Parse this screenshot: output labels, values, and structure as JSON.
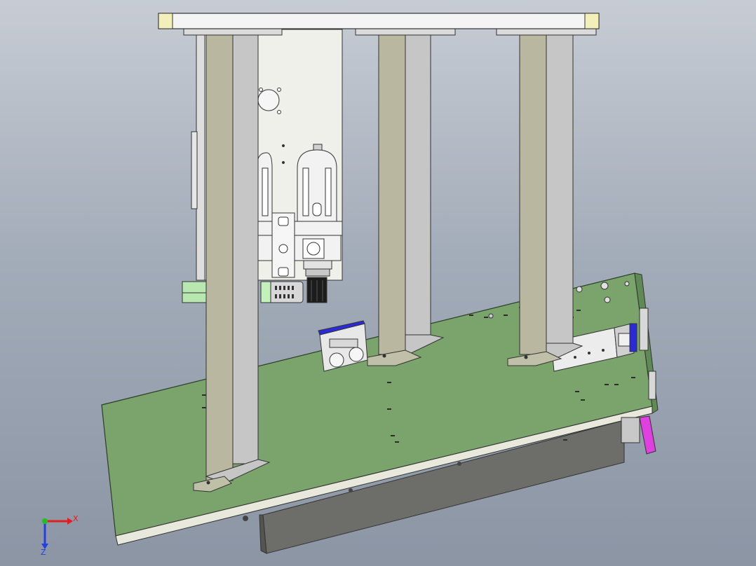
{
  "viewport": {
    "background_top": "#c7ccd4",
    "background_bottom": "#8b95a4"
  },
  "colors": {
    "base_plate": "#7aa46c",
    "column_face": "#b9b79f",
    "column_side": "#c6c6c6",
    "top_plate": "#f4f4f4",
    "top_plate_pads": "#f3efb8",
    "wall_panel": "#f0f0ea",
    "dark_block": "#6d6d69",
    "magenta_part": "#e040e0",
    "blue_part": "#2a2ad8",
    "green_fitting": "#b8e8b0",
    "axis_x": "#e02020",
    "axis_y": "#20c020",
    "axis_z": "#2040e0"
  },
  "triad": {
    "x_label": "X",
    "z_label": "Z"
  },
  "icons": {
    "filter_regulator": "filter-regulator-icon",
    "cylinder": "air-cylinder-icon",
    "triad": "axis-triad-icon"
  }
}
